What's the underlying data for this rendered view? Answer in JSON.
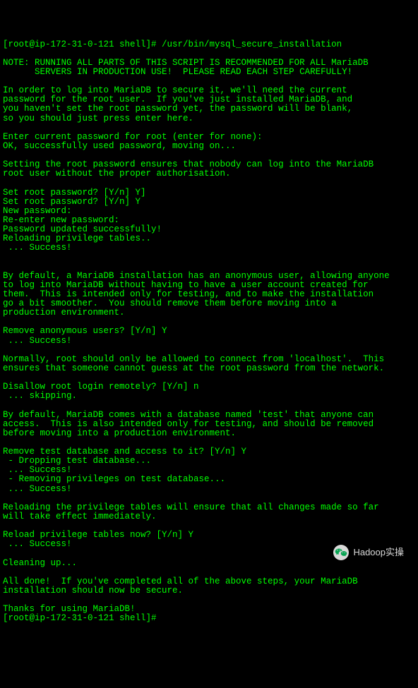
{
  "terminal": {
    "lines": [
      "[root@ip-172-31-0-121 shell]# /usr/bin/mysql_secure_installation",
      "",
      "NOTE: RUNNING ALL PARTS OF THIS SCRIPT IS RECOMMENDED FOR ALL MariaDB",
      "      SERVERS IN PRODUCTION USE!  PLEASE READ EACH STEP CAREFULLY!",
      "",
      "In order to log into MariaDB to secure it, we'll need the current",
      "password for the root user.  If you've just installed MariaDB, and",
      "you haven't set the root password yet, the password will be blank,",
      "so you should just press enter here.",
      "",
      "Enter current password for root (enter for none):",
      "OK, successfully used password, moving on...",
      "",
      "Setting the root password ensures that nobody can log into the MariaDB",
      "root user without the proper authorisation.",
      "",
      "Set root password? [Y/n] Y]",
      "Set root password? [Y/n] Y",
      "New password:",
      "Re-enter new password:",
      "Password updated successfully!",
      "Reloading privilege tables..",
      " ... Success!",
      "",
      "",
      "By default, a MariaDB installation has an anonymous user, allowing anyone",
      "to log into MariaDB without having to have a user account created for",
      "them.  This is intended only for testing, and to make the installation",
      "go a bit smoother.  You should remove them before moving into a",
      "production environment.",
      "",
      "Remove anonymous users? [Y/n] Y",
      " ... Success!",
      "",
      "Normally, root should only be allowed to connect from 'localhost'.  This",
      "ensures that someone cannot guess at the root password from the network.",
      "",
      "Disallow root login remotely? [Y/n] n",
      " ... skipping.",
      "",
      "By default, MariaDB comes with a database named 'test' that anyone can",
      "access.  This is also intended only for testing, and should be removed",
      "before moving into a production environment.",
      "",
      "Remove test database and access to it? [Y/n] Y",
      " - Dropping test database...",
      " ... Success!",
      " - Removing privileges on test database...",
      " ... Success!",
      "",
      "Reloading the privilege tables will ensure that all changes made so far",
      "will take effect immediately.",
      "",
      "Reload privilege tables now? [Y/n] Y",
      " ... Success!",
      "",
      "Cleaning up...",
      "",
      "All done!  If you've completed all of the above steps, your MariaDB",
      "installation should now be secure.",
      "",
      "Thanks for using MariaDB!",
      "[root@ip-172-31-0-121 shell]#"
    ]
  },
  "watermark": {
    "label": "Hadoop实操"
  }
}
